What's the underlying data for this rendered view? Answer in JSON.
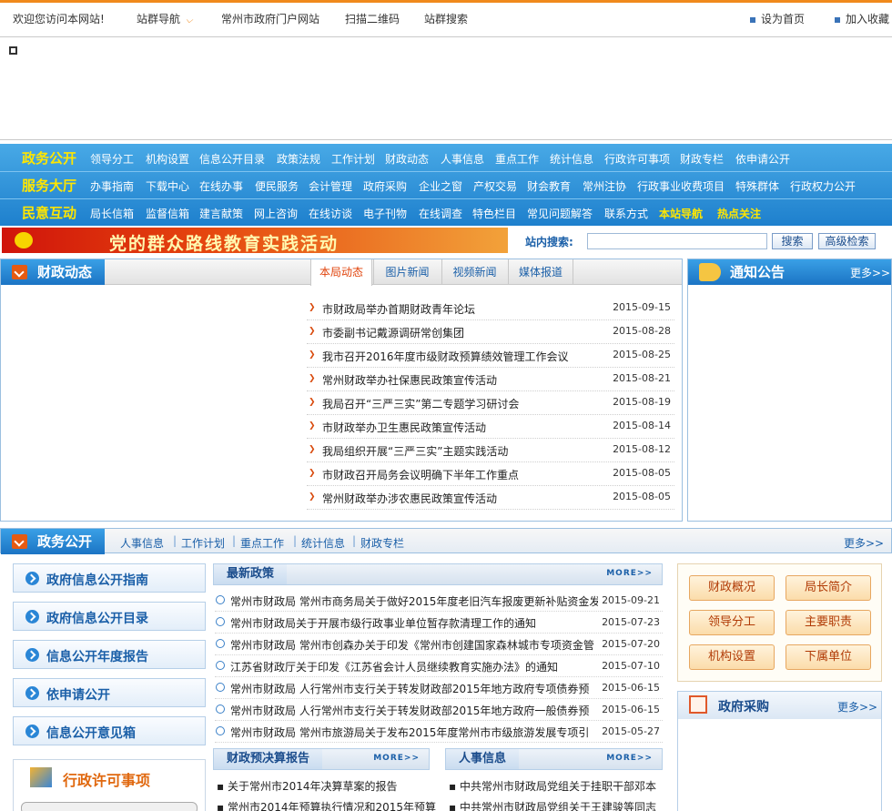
{
  "topbar": {
    "welcome": "欢迎您访问本网站!",
    "site_nav": "站群导航",
    "gov_portal": "常州市政府门户网站",
    "qr": "扫描二维码",
    "site_search": "站群搜索",
    "set_home": "设为首页",
    "add_fav": "加入收藏"
  },
  "nav": {
    "rows": [
      {
        "title": "政务公开",
        "items": [
          "领导分工",
          "机构设置",
          "信息公开目录",
          "政策法规",
          "工作计划",
          "财政动态",
          "人事信息",
          "重点工作",
          "统计信息",
          "行政许可事项",
          "财政专栏",
          "依申请公开"
        ]
      },
      {
        "title": "服务大厅",
        "items": [
          "办事指南",
          "下载中心",
          "在线办事",
          "便民服务",
          "会计管理",
          "政府采购",
          "企业之窗",
          "产权交易",
          "财会教育",
          "常州注协",
          "行政事业收费项目",
          "特殊群体",
          "行政权力公开"
        ]
      },
      {
        "title": "民意互动",
        "items": [
          "局长信箱",
          "监督信箱",
          "建言献策",
          "网上咨询",
          "在线访谈",
          "电子刊物",
          "在线调查",
          "特色栏目",
          "常见问题解答",
          "联系方式"
        ],
        "highlights": [
          "本站导航",
          "热点关注"
        ]
      }
    ]
  },
  "ad": {
    "banner_text": "党的群众路线教育实践活动"
  },
  "search": {
    "label": "站内搜索:",
    "placeholder": "",
    "button": "搜索",
    "advanced": "高级检索"
  },
  "caizheng": {
    "title": "财政动态",
    "tabs": [
      "本局动态",
      "图片新闻",
      "视频新闻",
      "媒体报道"
    ],
    "news": [
      {
        "title": "市财政局举办首期财政青年论坛",
        "date": "2015-09-15"
      },
      {
        "title": "市委副书记戴源调研常创集团",
        "date": "2015-08-28"
      },
      {
        "title": "我市召开2016年度市级财政预算绩效管理工作会议",
        "date": "2015-08-25"
      },
      {
        "title": "常州财政举办社保惠民政策宣传活动",
        "date": "2015-08-21"
      },
      {
        "title": "我局召开“三严三实”第二专题学习研讨会",
        "date": "2015-08-19"
      },
      {
        "title": "市财政举办卫生惠民政策宣传活动",
        "date": "2015-08-14"
      },
      {
        "title": "我局组织开展“三严三实”主题实践活动",
        "date": "2015-08-12"
      },
      {
        "title": "市财政召开局务会议明确下半年工作重点",
        "date": "2015-08-05"
      },
      {
        "title": "常州财政举办涉农惠民政策宣传活动",
        "date": "2015-08-05"
      }
    ]
  },
  "notice": {
    "title": "通知公告",
    "more": "更多>>"
  },
  "zhengwu": {
    "title": "政务公开",
    "links": [
      "人事信息",
      "工作计划",
      "重点工作",
      "统计信息",
      "财政专栏"
    ],
    "more": "更多>>"
  },
  "left_buttons": [
    "政府信息公开指南",
    "政府信息公开目录",
    "信息公开年度报告",
    "依申请公开",
    "信息公开意见箱"
  ],
  "xingzheng": {
    "title": "行政许可事项"
  },
  "latest_policy": {
    "title": "最新政策",
    "more": "MORE>>",
    "items": [
      {
        "title": "常州市财政局 常州市商务局关于做好2015年度老旧汽车报废更新补贴资金发",
        "date": "2015-09-21"
      },
      {
        "title": "常州市财政局关于开展市级行政事业单位暂存款清理工作的通知",
        "date": "2015-07-23"
      },
      {
        "title": "常州市财政局 常州市创森办关于印发《常州市创建国家森林城市专项资金管",
        "date": "2015-07-20"
      },
      {
        "title": "江苏省财政厅关于印发《江苏省会计人员继续教育实施办法》的通知",
        "date": "2015-07-10"
      },
      {
        "title": "常州市财政局 人行常州市支行关于转发财政部2015年地方政府专项债券预",
        "date": "2015-06-15"
      },
      {
        "title": "常州市财政局 人行常州市支行关于转发财政部2015年地方政府一般债券预",
        "date": "2015-06-15"
      },
      {
        "title": "常州市财政局 常州市旅游局关于发布2015年度常州市市级旅游发展专项引",
        "date": "2015-05-27"
      }
    ]
  },
  "budget": {
    "title": "财政预决算报告",
    "more": "MORE>>",
    "items": [
      "关于常州市2014年决算草案的报告",
      "常州市2014年预算执行情况和2015年预算"
    ]
  },
  "personnel": {
    "title": "人事信息",
    "more": "MORE>>",
    "items": [
      "中共常州市财政局党组关于挂职干部邓本",
      "中共常州市财政局党组关于王建骏等同志"
    ]
  },
  "quick": [
    "财政概况",
    "局长简介",
    "领导分工",
    "主要职责",
    "机构设置",
    "下属单位"
  ],
  "procurement": {
    "title": "政府采购",
    "more": "更多>>"
  },
  "colors": {
    "accent_orange": "#f08a1c",
    "nav_blue": "#1e80cd",
    "nav_title_yellow": "#ffe600",
    "date_color": "#333333"
  }
}
